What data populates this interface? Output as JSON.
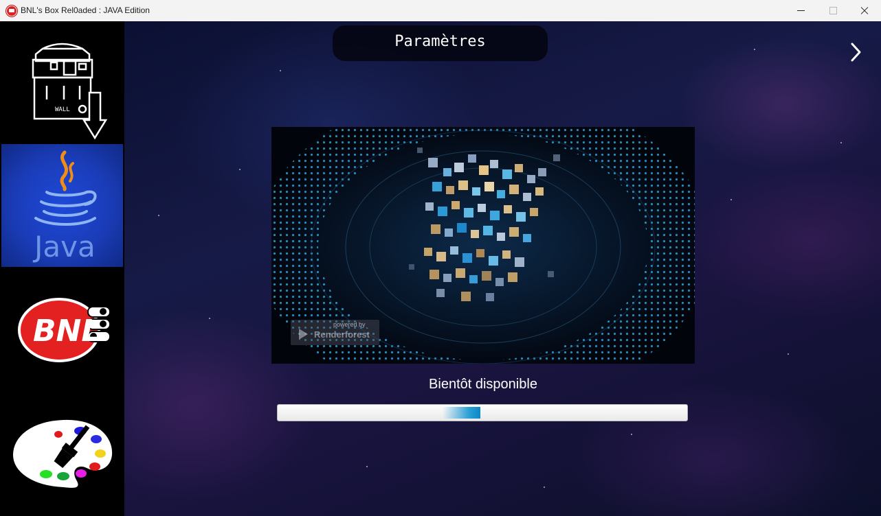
{
  "window": {
    "title": "BNL's Box Rel0aded : JAVA Edition",
    "icon": "bnl-app-icon",
    "controls": [
      "minimize",
      "maximize",
      "close"
    ]
  },
  "sidebar": {
    "items": [
      {
        "name": "wall-e-download",
        "icon": "wall-e-download-icon",
        "logo_text": "WALL",
        "selected": false
      },
      {
        "name": "java",
        "icon": "java-icon",
        "logo_text": "Java",
        "selected": true
      },
      {
        "name": "bnl",
        "icon": "bnl-logo-icon",
        "logo_text": "BNL",
        "selected": false
      },
      {
        "name": "paint",
        "icon": "palette-icon",
        "selected": false
      }
    ],
    "selected_background": "#1a3cb8"
  },
  "main": {
    "header_title": "Paramètres",
    "next_icon": "chevron-right-icon",
    "video": {
      "watermark_top": "powered by",
      "watermark_brand": "Renderforest"
    },
    "status_text": "Bientôt disponible",
    "progress": {
      "mode": "indeterminate",
      "accent": "#0a87c9"
    }
  },
  "colors": {
    "titlebar": "#f3f3f3",
    "sidebar": "#000000",
    "text": "#ffffff"
  }
}
